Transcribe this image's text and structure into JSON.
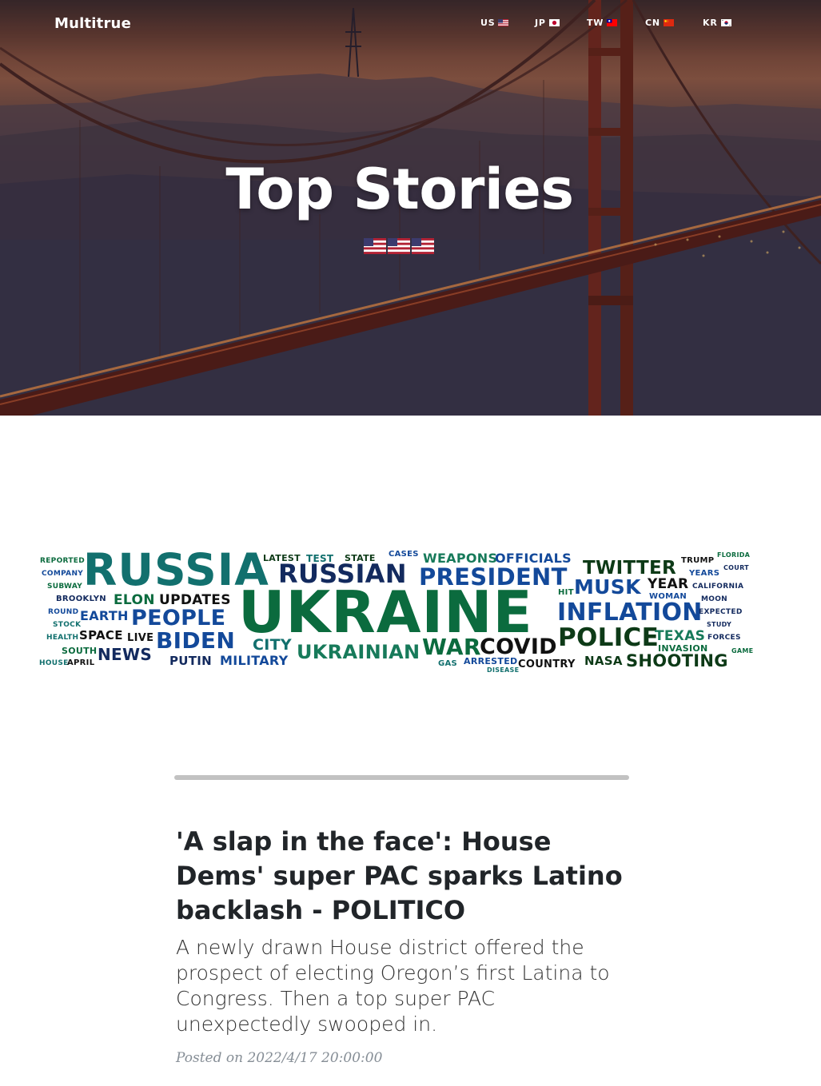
{
  "brand": "Multitrue",
  "nav": [
    {
      "label": "US",
      "flag": "us-flag-icon"
    },
    {
      "label": "JP",
      "flag": "jp-flag-icon"
    },
    {
      "label": "TW",
      "flag": "tw-flag-icon"
    },
    {
      "label": "CN",
      "flag": "cn-flag-icon"
    },
    {
      "label": "KR",
      "flag": "kr-flag-icon"
    }
  ],
  "hero": {
    "title": "Top Stories",
    "flags": [
      "us-flag-icon",
      "us-flag-icon",
      "us-flag-icon"
    ]
  },
  "word_cloud": {
    "colors": {
      "teal": "#12706e",
      "green": "#0b6b3e",
      "navy": "#132a5e",
      "blue": "#13499a",
      "dark": "#111111",
      "darkgreen": "#0d3a17",
      "seagreen": "#177a5a"
    },
    "words": [
      "REPORTED",
      "COMPANY",
      "SUBWAY",
      "BROOKLYN",
      "ROUND",
      "STOCK",
      "HEALTH",
      "SOUTH",
      "HOUSE",
      "APRIL",
      "RUSSIA",
      "ELON",
      "UPDATES",
      "EARTH",
      "PEOPLE",
      "SPACE",
      "LIVE",
      "BIDEN",
      "NEWS",
      "PUTIN",
      "MILITARY",
      "LATEST",
      "TEST",
      "STATE",
      "CASES",
      "WEAPONS",
      "OFFICIALS",
      "RUSSIAN",
      "PRESIDENT",
      "UKRAINE",
      "CITY",
      "UKRAINIAN",
      "WAR",
      "COVID",
      "GAS",
      "ARRESTED",
      "DISEASE",
      "COUNTRY",
      "TWITTER",
      "MUSK",
      "HIT",
      "INFLATION",
      "POLICE",
      "NASA",
      "SHOOTING",
      "TEXAS",
      "INVASION",
      "YEAR",
      "WOMAN",
      "TRUMP",
      "YEARS",
      "FLORIDA",
      "COURT",
      "CALIFORNIA",
      "MOON",
      "EXPECTED",
      "STUDY",
      "FORCES",
      "GAME"
    ]
  },
  "post": {
    "title": "'A slap in the face': House Dems' super PAC sparks Latino backlash - POLITICO",
    "subtitle": "A newly drawn House district offered the prospect of electing Oregon’s first Latina to Congress. Then a top super PAC unexpectedly swooped in.",
    "meta": "Posted on 2022/4/17 20:00:00"
  }
}
